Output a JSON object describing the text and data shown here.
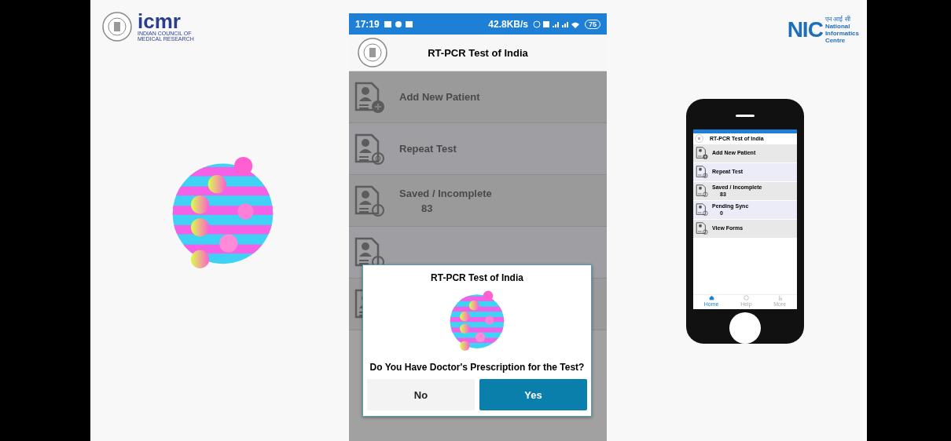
{
  "icmr_logo": {
    "wordmark": "icmr",
    "name_lines": [
      "INDIAN COUNCIL OF",
      "MEDICAL RESEARCH"
    ]
  },
  "phone": {
    "status_bar": {
      "time": "17:19",
      "speed": "42.8KB/s",
      "battery": "75"
    },
    "app_title": "RT-PCR Test of India",
    "menu": [
      {
        "kind": "add",
        "label": "Add New Patient"
      },
      {
        "kind": "repeat",
        "label": "Repeat Test"
      },
      {
        "kind": "saved",
        "label": "Saved / Incomplete",
        "count": "83"
      },
      {
        "kind": "pending"
      },
      {
        "kind": "forms"
      }
    ],
    "dialog": {
      "title": "RT-PCR Test of India",
      "question": "Do You Have Doctor's Prescription for the Test?",
      "buttons": [
        {
          "label": "No",
          "kind": "secondary"
        },
        {
          "label": "Yes",
          "kind": "primary"
        }
      ]
    }
  },
  "nic_logo": {
    "wordmark": "NIC",
    "hindi": "एन आई सी",
    "name_lines": [
      "National",
      "Informatics",
      "Centre"
    ]
  },
  "mockup": {
    "app_title": "RT-PCR Test of India",
    "menu": [
      {
        "kind": "add",
        "label": "Add New Patient"
      },
      {
        "kind": "repeat",
        "label": "Repeat Test"
      },
      {
        "kind": "saved",
        "label": "Saved / Incomplete",
        "count": "83"
      },
      {
        "kind": "pending",
        "label": "Pending Sync",
        "count": "0"
      },
      {
        "kind": "forms",
        "label": "View Forms"
      }
    ],
    "nav": [
      {
        "label": "Home",
        "kind": "home",
        "selected": true
      },
      {
        "label": "Help",
        "kind": "help",
        "selected": false
      },
      {
        "label": "More",
        "kind": "more",
        "selected": false
      }
    ]
  }
}
